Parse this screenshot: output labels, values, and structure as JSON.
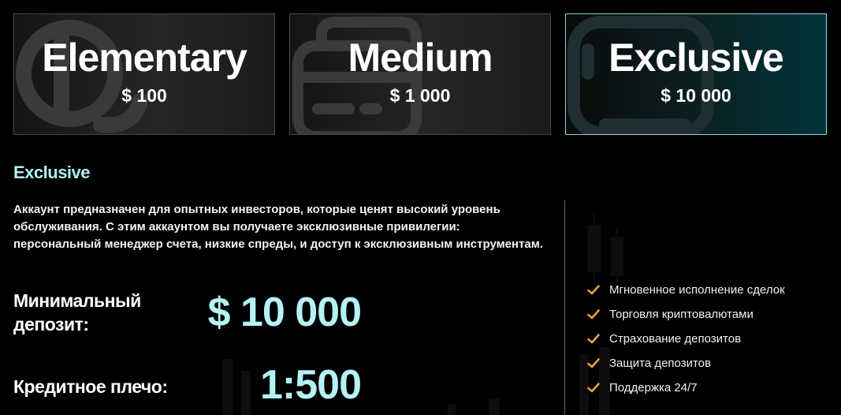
{
  "plans": [
    {
      "name": "Elementary",
      "price": "$ 100",
      "icon": "coin-icon",
      "selected": false
    },
    {
      "name": "Medium",
      "price": "$ 1 000",
      "icon": "wallet-icon",
      "selected": false
    },
    {
      "name": "Exclusive",
      "price": "$ 10 000",
      "icon": "safe-icon",
      "selected": true
    }
  ],
  "detail": {
    "title": "Exclusive",
    "description": "Аккаунт предназначен для опытных инвесторов, которые ценят высокий уровень обслуживания. С этим аккаунтом вы получаете эксклюзивные привилегии: персональный менеджер счета, низкие спреды, и доступ к эксклюзивным инструментам.",
    "min_deposit_label_line1": "Минимальный",
    "min_deposit_label_line2": "депозит:",
    "min_deposit_value": "$ 10 000",
    "leverage_label": "Кредитное плечо:",
    "leverage_value": "1:500"
  },
  "features": [
    "Мгновенное исполнение сделок",
    "Торговля криптовалютами",
    "Страхование депозитов",
    "Защита депозитов",
    "Поддержка 24/7"
  ],
  "colors": {
    "accent": "#aef0f2",
    "check": "#f2a33a",
    "selected_border": "#8fd3d7"
  }
}
